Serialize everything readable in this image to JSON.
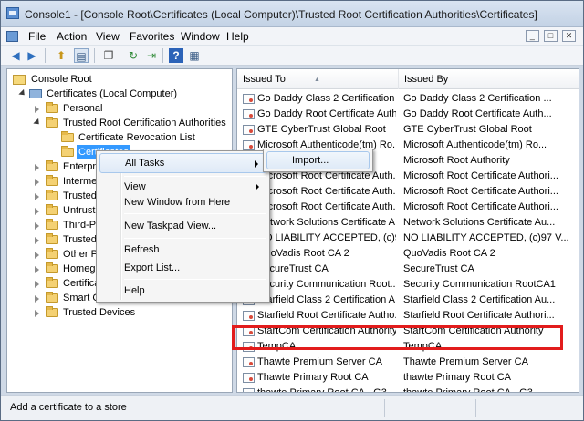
{
  "window": {
    "title": "Console1 - [Console Root\\Certificates (Local Computer)\\Trusted Root Certification Authorities\\Certificates]"
  },
  "menu": [
    "File",
    "Action",
    "View",
    "Favorites",
    "Window",
    "Help"
  ],
  "mdi_buttons": [
    "_",
    "□",
    "✕"
  ],
  "toolbar": [
    {
      "icon": "back-arrow-icon",
      "glyph": "◀"
    },
    {
      "icon": "forward-arrow-icon",
      "glyph": "▶"
    },
    {
      "icon": "up-folder-icon",
      "glyph": "⬆"
    },
    {
      "icon": "show-hide-tree-icon",
      "glyph": "▤"
    },
    {
      "icon": "properties-icon",
      "glyph": "❐"
    },
    {
      "icon": "refresh-icon",
      "glyph": "↻"
    },
    {
      "icon": "export-list-icon",
      "glyph": "⇥"
    },
    {
      "icon": "help-icon",
      "glyph": "?"
    },
    {
      "icon": "action-pane-icon",
      "glyph": "▦"
    }
  ],
  "tree": [
    {
      "label": "Console Root",
      "level": 0,
      "icon": "root",
      "twisty": "none"
    },
    {
      "label": "Certificates (Local Computer)",
      "level": 1,
      "icon": "computer",
      "twisty": "open"
    },
    {
      "label": "Personal",
      "level": 2,
      "icon": "folder",
      "twisty": "closed"
    },
    {
      "label": "Trusted Root Certification Authorities",
      "level": 2,
      "icon": "folder",
      "twisty": "open"
    },
    {
      "label": "Certificate Revocation List",
      "level": 3,
      "icon": "folder",
      "twisty": "none"
    },
    {
      "label": "Certificates",
      "level": 3,
      "icon": "folder",
      "twisty": "none",
      "selected": true
    },
    {
      "label": "Enterprise Trust",
      "level": 2,
      "icon": "folder",
      "twisty": "closed"
    },
    {
      "label": "Intermediate Certification Authorities",
      "level": 2,
      "icon": "folder",
      "twisty": "closed"
    },
    {
      "label": "Trusted Publishers",
      "level": 2,
      "icon": "folder",
      "twisty": "closed"
    },
    {
      "label": "Untrusted Certificates",
      "level": 2,
      "icon": "folder",
      "twisty": "closed"
    },
    {
      "label": "Third-Party Root Certification Authorities",
      "level": 2,
      "icon": "folder",
      "twisty": "closed"
    },
    {
      "label": "Trusted People",
      "level": 2,
      "icon": "folder",
      "twisty": "closed"
    },
    {
      "label": "Other People",
      "level": 2,
      "icon": "folder",
      "twisty": "closed"
    },
    {
      "label": "Homegroup Machine Certificates",
      "level": 2,
      "icon": "folder",
      "twisty": "closed"
    },
    {
      "label": "Certificate Enrollment Requests",
      "level": 2,
      "icon": "folder",
      "twisty": "closed"
    },
    {
      "label": "Smart Card Trusted Roots",
      "level": 2,
      "icon": "folder",
      "twisty": "closed"
    },
    {
      "label": "Trusted Devices",
      "level": 2,
      "icon": "folder",
      "twisty": "closed"
    }
  ],
  "columns": [
    "Issued To",
    "Issued By"
  ],
  "rows": [
    [
      "Go Daddy Class 2 Certification ...",
      "Go Daddy Class 2 Certification ..."
    ],
    [
      "Go Daddy Root Certificate Auth...",
      "Go Daddy Root Certificate Auth..."
    ],
    [
      "GTE CyberTrust Global Root",
      "GTE CyberTrust Global Root"
    ],
    [
      "Microsoft Authenticode(tm) Ro...",
      "Microsoft Authenticode(tm) Ro..."
    ],
    [
      "Microsoft Root Authority",
      "Microsoft Root Authority"
    ],
    [
      "Microsoft Root Certificate Auth...",
      "Microsoft Root Certificate Authori..."
    ],
    [
      "Microsoft Root Certificate Auth...",
      "Microsoft Root Certificate Authori..."
    ],
    [
      "Microsoft Root Certificate Auth...",
      "Microsoft Root Certificate Authori..."
    ],
    [
      "Network Solutions Certificate A...",
      "Network Solutions Certificate Au..."
    ],
    [
      "NO LIABILITY ACCEPTED, (c)97 ...",
      "NO LIABILITY ACCEPTED, (c)97 V..."
    ],
    [
      "QuoVadis Root CA 2",
      "QuoVadis Root CA 2"
    ],
    [
      "SecureTrust CA",
      "SecureTrust CA"
    ],
    [
      "Security Communication Root...",
      "Security Communication RootCA1"
    ],
    [
      "Starfield Class 2 Certification A...",
      "Starfield Class 2 Certification Au..."
    ],
    [
      "Starfield Root Certificate Autho...",
      "Starfield Root Certificate Authori..."
    ],
    [
      "StartCom Certification Authority",
      "StartCom Certification Authority"
    ],
    [
      "TempCA",
      "TempCA"
    ],
    [
      "Thawte Premium Server CA",
      "Thawte Premium Server CA"
    ],
    [
      "Thawte Primary Root CA",
      "thawte Primary Root CA"
    ],
    [
      "thawte Primary Root CA - G3",
      "thawte Primary Root CA - G3"
    ]
  ],
  "context_menu": {
    "items": [
      {
        "label": "All Tasks",
        "submenu": true,
        "hot": true
      },
      {
        "separator": true
      },
      {
        "label": "View",
        "submenu": true
      },
      {
        "label": "New Window from Here"
      },
      {
        "separator": true
      },
      {
        "label": "New Taskpad View..."
      },
      {
        "separator": true
      },
      {
        "label": "Refresh"
      },
      {
        "label": "Export List..."
      },
      {
        "separator": true
      },
      {
        "label": "Help"
      }
    ]
  },
  "submenu": {
    "label": "Import..."
  },
  "status": {
    "text": "Add a certificate to a store"
  },
  "colors": {
    "highlight": "#e21c1c",
    "selection": "#3399ff"
  }
}
